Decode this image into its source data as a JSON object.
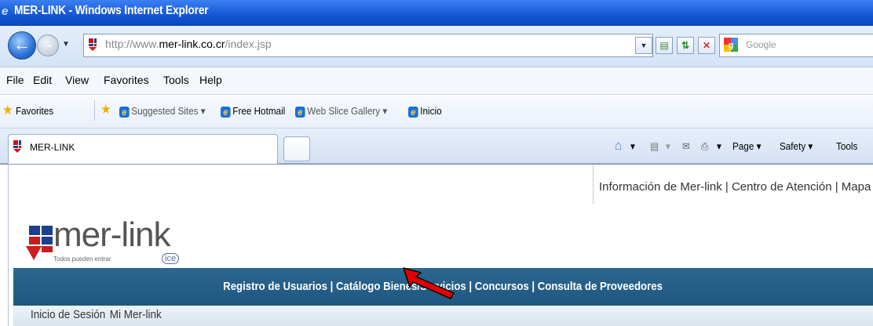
{
  "window": {
    "title": "MER-LINK - Windows Internet Explorer"
  },
  "address_bar": {
    "url_prefix": "http://www.",
    "url_domain": "mer-link.co.cr",
    "url_suffix": "/index.jsp"
  },
  "search": {
    "placeholder": "Google"
  },
  "menu": [
    "File",
    "Edit",
    "View",
    "Favorites",
    "Tools",
    "Help"
  ],
  "favorites_bar": {
    "favorites_label": "Favorites",
    "items": [
      "Suggested Sites ▾",
      "Free Hotmail",
      "Web Slice Gallery ▾",
      "Inicio"
    ]
  },
  "tab": {
    "label": "MER-LINK"
  },
  "command_bar": {
    "page": "Page ▾",
    "safety": "Safety ▾",
    "tools": "Tools"
  },
  "page": {
    "top_links": "Información de Mer-link | Centro de Atención | Mapa d",
    "logo": {
      "text": "mer-link",
      "tagline": "Todos pueden entrar",
      "badge": "ice"
    },
    "main_nav": "Registro de Usuarios | Catálogo Bienes/Servicios | Concursos | Consulta de Proveedores",
    "sub_nav": {
      "login": "Inicio de Sesión",
      "mine": "Mi Mer-link"
    }
  },
  "colors": {
    "nav_band": "#236086",
    "titlebar": "#1658d6",
    "pointer_arrow": "#e20000"
  }
}
